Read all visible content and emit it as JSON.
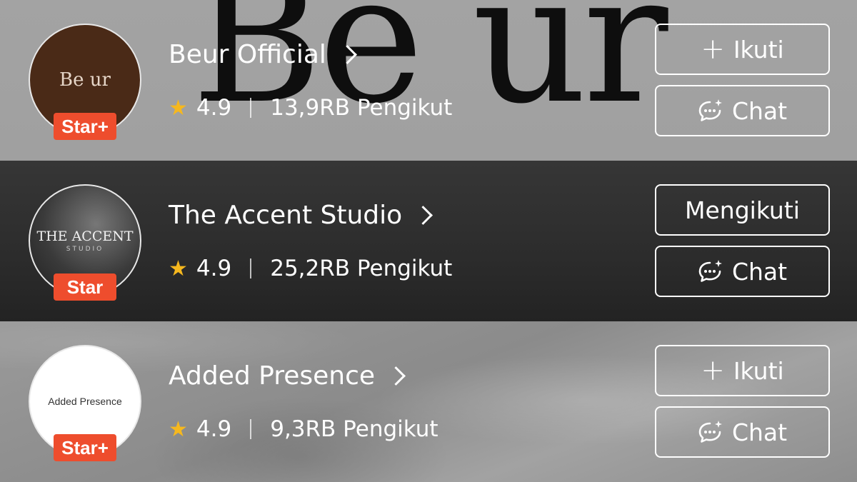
{
  "banner": {
    "text": "Be ur"
  },
  "shops": [
    {
      "logo_text": "Be ur",
      "logo_sub": "",
      "badge": "Star+",
      "name": "Beur Official",
      "rating": "4.9",
      "followers": "13,9RB Pengikut",
      "follow_label": "Ikuti",
      "follow_state": "not-following",
      "chat_label": "Chat"
    },
    {
      "logo_text": "THE ACCENT",
      "logo_sub": "STUDIO",
      "badge": "Star",
      "name": "The Accent Studio",
      "rating": "4.9",
      "followers": "25,2RB Pengikut",
      "follow_label": "Mengikuti",
      "follow_state": "following",
      "chat_label": "Chat"
    },
    {
      "logo_text": "Added Presence",
      "logo_sub": "",
      "badge": "Star+",
      "name": "Added Presence",
      "rating": "4.9",
      "followers": "9,3RB Pengikut",
      "follow_label": "Ikuti",
      "follow_state": "not-following",
      "chat_label": "Chat"
    }
  ],
  "colors": {
    "badge": "#ee4d2d",
    "star": "#f6b81e"
  },
  "icons": {
    "follow": "plus-icon",
    "chat": "chat-bubble-icon",
    "rating": "star-icon",
    "name": "chevron-right-icon"
  }
}
